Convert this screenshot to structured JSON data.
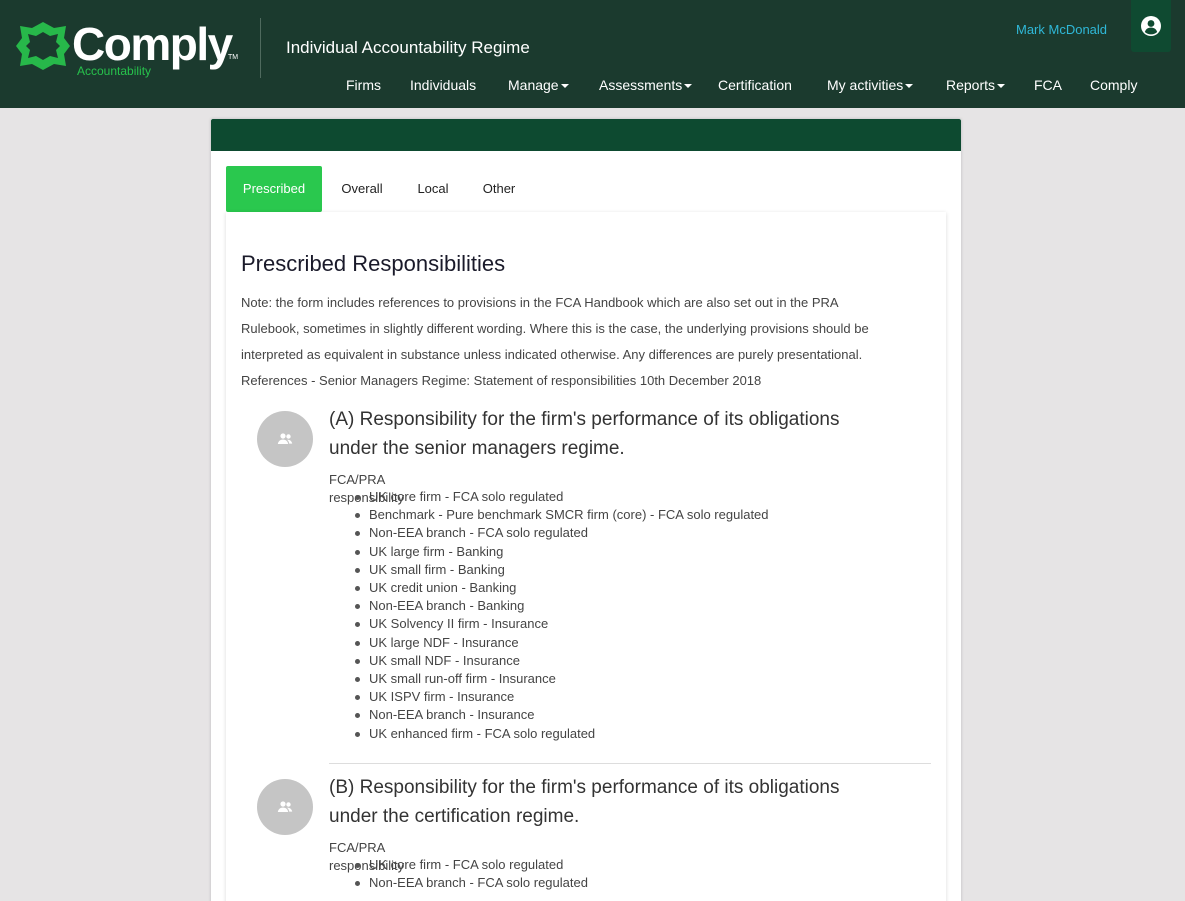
{
  "brand": {
    "name": "Comply",
    "tagline": "Accountability",
    "tm": "TM",
    "colors": {
      "header_bg": "#1b3a2e",
      "accent_green": "#2ac84e",
      "dark_green": "#0d4a30",
      "user_link": "#2fb8d8"
    }
  },
  "header": {
    "app_title": "Individual Accountability Regime",
    "user_name": "Mark McDonald",
    "user_icon": "user-circle-icon"
  },
  "nav": [
    {
      "label": "Firms",
      "dropdown": false
    },
    {
      "label": "Individuals",
      "dropdown": false
    },
    {
      "label": "Manage",
      "dropdown": true
    },
    {
      "label": "Assessments",
      "dropdown": true
    },
    {
      "label": "Certification",
      "dropdown": false
    },
    {
      "label": "My activities",
      "dropdown": true
    },
    {
      "label": "Reports",
      "dropdown": true
    },
    {
      "label": "FCA",
      "dropdown": false
    },
    {
      "label": "Comply",
      "dropdown": false
    }
  ],
  "tabs": [
    {
      "label": "Prescribed",
      "active": true
    },
    {
      "label": "Overall",
      "active": false
    },
    {
      "label": "Local",
      "active": false
    },
    {
      "label": "Other",
      "active": false
    }
  ],
  "content": {
    "heading": "Prescribed Responsibilities",
    "note_lines": [
      "Note: the form includes references to provisions in the FCA Handbook which are also set out in the PRA",
      "Rulebook, sometimes in slightly different wording. Where this is the case, the underlying provisions should be",
      "interpreted as equivalent in substance unless indicated otherwise. Any differences are purely presentational.",
      "References - Senior Managers Regime: Statement of responsibilities 10th December 2018"
    ],
    "responsibilities": [
      {
        "title_lines": [
          "(A) Responsibility for the firm's performance of its obligations",
          "under the senior managers regime."
        ],
        "subtitle": "FCA/PRA responsibility",
        "items": [
          "UK core firm - FCA solo regulated",
          "Benchmark - Pure benchmark SMCR firm (core) - FCA solo regulated",
          "Non-EEA branch - FCA solo regulated",
          "UK large firm - Banking",
          "UK small firm - Banking",
          "UK credit union - Banking",
          "Non-EEA branch - Banking",
          "UK Solvency II firm - Insurance",
          "UK large NDF - Insurance",
          "UK small NDF - Insurance",
          "UK small run-off firm - Insurance",
          "UK ISPV firm - Insurance",
          "Non-EEA branch - Insurance",
          "UK enhanced firm - FCA solo regulated"
        ]
      },
      {
        "title_lines": [
          "(B) Responsibility for the firm's performance of its obligations",
          "under the certification regime."
        ],
        "subtitle": "FCA/PRA responsibility",
        "items": [
          "UK core firm - FCA solo regulated",
          "Non-EEA branch - FCA solo regulated"
        ]
      }
    ]
  }
}
